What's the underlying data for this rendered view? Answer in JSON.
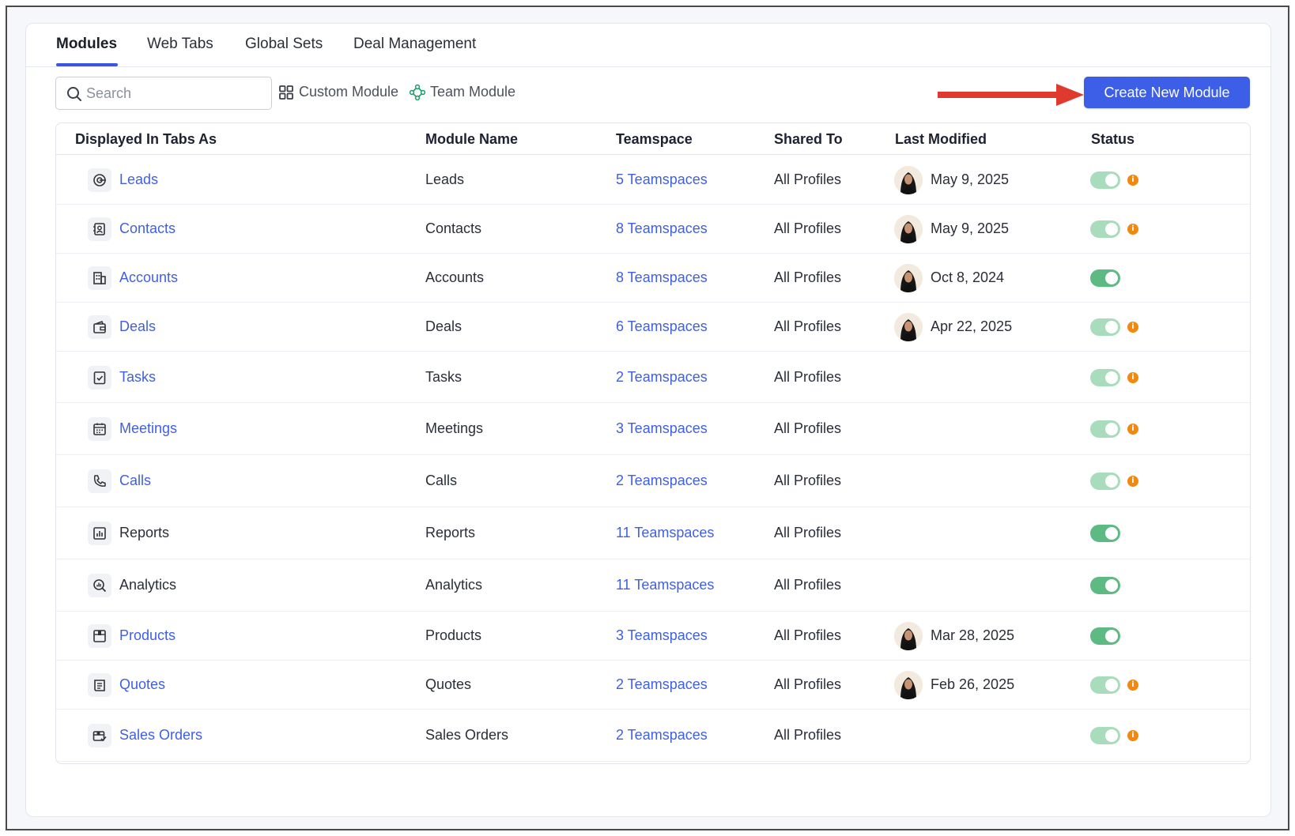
{
  "tabs": [
    {
      "label": "Modules",
      "active": true
    },
    {
      "label": "Web Tabs",
      "active": false
    },
    {
      "label": "Global Sets",
      "active": false
    },
    {
      "label": "Deal Management",
      "active": false
    }
  ],
  "toolbar": {
    "search_placeholder": "Search",
    "custom_module_label": "Custom Module",
    "team_module_label": "Team Module",
    "create_button_label": "Create New Module"
  },
  "colors": {
    "accent": "#3d5fe7",
    "link": "#4060e0",
    "toggle_on": "#5cba82",
    "toggle_on_faded": "#a9dcbc",
    "warning": "#f08a0e",
    "arrow": "#e03a2f"
  },
  "table": {
    "headers": [
      "Displayed In Tabs As",
      "Module Name",
      "Teamspace",
      "Shared To",
      "Last Modified",
      "Status"
    ],
    "rows": [
      {
        "tab": "Leads",
        "icon": "leads-icon",
        "module": "Leads",
        "teamspace": "5 Teamspaces",
        "shared": "All Profiles",
        "modified": "May 9, 2025",
        "has_avatar": true,
        "status_on": true,
        "faded": true,
        "info": true,
        "tab_link": true
      },
      {
        "tab": "Contacts",
        "icon": "contacts-icon",
        "module": "Contacts",
        "teamspace": "8 Teamspaces",
        "shared": "All Profiles",
        "modified": "May 9, 2025",
        "has_avatar": true,
        "status_on": true,
        "faded": true,
        "info": true,
        "tab_link": true
      },
      {
        "tab": "Accounts",
        "icon": "accounts-icon",
        "module": "Accounts",
        "teamspace": "8 Teamspaces",
        "shared": "All Profiles",
        "modified": "Oct 8, 2024",
        "has_avatar": true,
        "status_on": true,
        "faded": false,
        "info": false,
        "tab_link": true
      },
      {
        "tab": "Deals",
        "icon": "deals-icon",
        "module": "Deals",
        "teamspace": "6 Teamspaces",
        "shared": "All Profiles",
        "modified": "Apr 22, 2025",
        "has_avatar": true,
        "status_on": true,
        "faded": true,
        "info": true,
        "tab_link": true
      },
      {
        "tab": "Tasks",
        "icon": "tasks-icon",
        "module": "Tasks",
        "teamspace": "2 Teamspaces",
        "shared": "All Profiles",
        "modified": "",
        "has_avatar": false,
        "status_on": true,
        "faded": true,
        "info": true,
        "tab_link": true
      },
      {
        "tab": "Meetings",
        "icon": "meetings-icon",
        "module": "Meetings",
        "teamspace": "3 Teamspaces",
        "shared": "All Profiles",
        "modified": "",
        "has_avatar": false,
        "status_on": true,
        "faded": true,
        "info": true,
        "tab_link": true
      },
      {
        "tab": "Calls",
        "icon": "calls-icon",
        "module": "Calls",
        "teamspace": "2 Teamspaces",
        "shared": "All Profiles",
        "modified": "",
        "has_avatar": false,
        "status_on": true,
        "faded": true,
        "info": true,
        "tab_link": true
      },
      {
        "tab": "Reports",
        "icon": "reports-icon",
        "module": "Reports",
        "teamspace": "11 Teamspaces",
        "shared": "All Profiles",
        "modified": "",
        "has_avatar": false,
        "status_on": true,
        "faded": false,
        "info": false,
        "tab_link": false
      },
      {
        "tab": "Analytics",
        "icon": "analytics-icon",
        "module": "Analytics",
        "teamspace": "11 Teamspaces",
        "shared": "All Profiles",
        "modified": "",
        "has_avatar": false,
        "status_on": true,
        "faded": false,
        "info": false,
        "tab_link": false
      },
      {
        "tab": "Products",
        "icon": "products-icon",
        "module": "Products",
        "teamspace": "3 Teamspaces",
        "shared": "All Profiles",
        "modified": "Mar 28, 2025",
        "has_avatar": true,
        "status_on": true,
        "faded": false,
        "info": false,
        "tab_link": true
      },
      {
        "tab": "Quotes",
        "icon": "quotes-icon",
        "module": "Quotes",
        "teamspace": "2 Teamspaces",
        "shared": "All Profiles",
        "modified": "Feb 26, 2025",
        "has_avatar": true,
        "status_on": true,
        "faded": true,
        "info": true,
        "tab_link": true
      },
      {
        "tab": "Sales Orders",
        "icon": "sales-orders-icon",
        "module": "Sales Orders",
        "teamspace": "2 Teamspaces",
        "shared": "All Profiles",
        "modified": "",
        "has_avatar": false,
        "status_on": true,
        "faded": true,
        "info": true,
        "tab_link": true
      }
    ]
  }
}
